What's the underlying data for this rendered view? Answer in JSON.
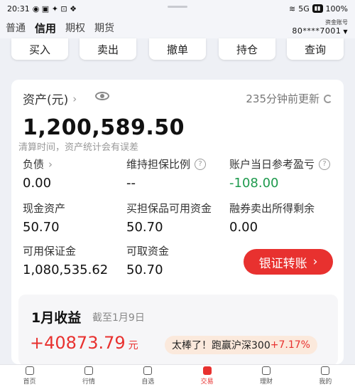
{
  "status": {
    "time": "20:31",
    "network": "5G",
    "battery": "100%"
  },
  "top_tabs": [
    "普通",
    "信用",
    "期权",
    "期货"
  ],
  "account": {
    "label": "资金账号",
    "number": "80****7001"
  },
  "actions": [
    "买入",
    "卖出",
    "撤单",
    "持仓",
    "查询"
  ],
  "asset": {
    "title": "资产(元)",
    "updated": "235分钟前更新",
    "total": "1,200,589.50",
    "note": "清算时间，资产统计会有误差"
  },
  "metrics": [
    {
      "label": "负债",
      "value": "0.00"
    },
    {
      "label": "维持担保比例",
      "value": "--"
    },
    {
      "label": "账户当日参考盈亏",
      "value": "-108.00"
    },
    {
      "label": "现金资产",
      "value": "50.70"
    },
    {
      "label": "买担保品可用资金",
      "value": "50.70"
    },
    {
      "label": "融券卖出所得剩余",
      "value": "0.00"
    },
    {
      "label": "可用保证金",
      "value": "1,080,535.62"
    },
    {
      "label": "可取资金",
      "value": "50.70"
    }
  ],
  "transfer_button": "银证转账",
  "income": {
    "title": "1月收益",
    "as_of": "截至1月9日",
    "amount": "+40873.79",
    "unit": "元",
    "badge_text": "太棒了！跑赢沪深300",
    "badge_pct": "+7.17%"
  },
  "bottom_nav": [
    "首页",
    "行情",
    "自选",
    "交易",
    "理财",
    "我的"
  ],
  "colors": {
    "accent": "#e8312f",
    "positive": "#1e9a4d"
  }
}
